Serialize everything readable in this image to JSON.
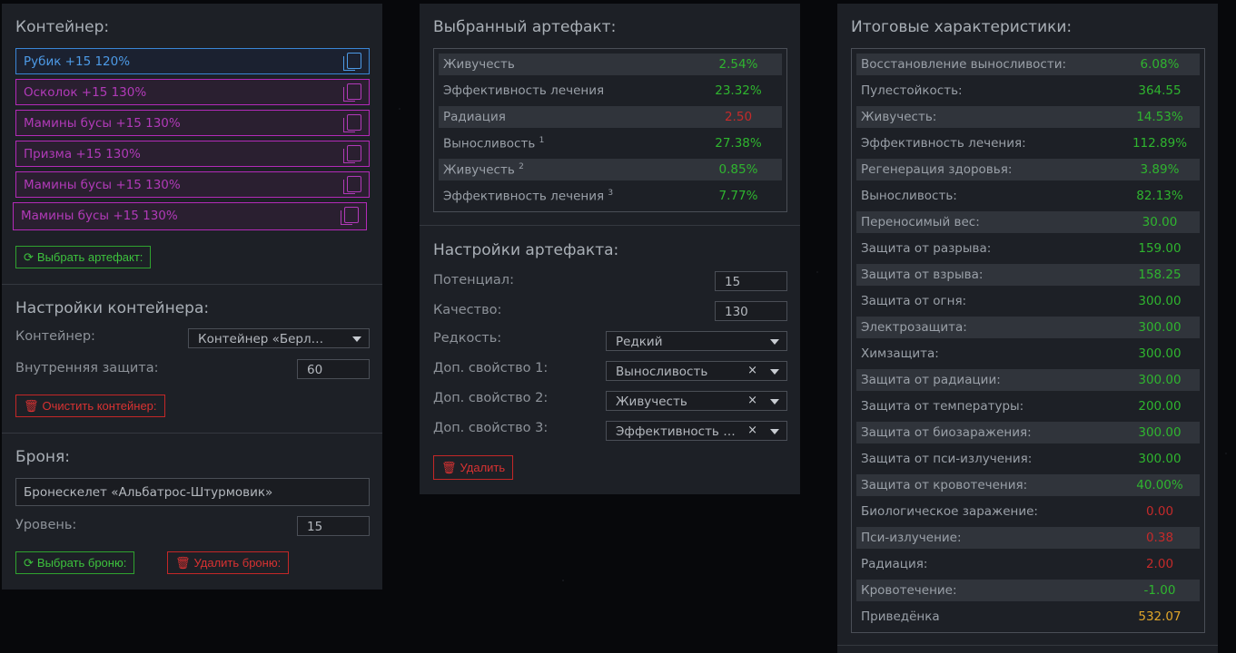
{
  "container_panel": {
    "title": "Контейнер:",
    "slots": [
      {
        "label": "Рубик +15 120%",
        "color": "#4d9ae6"
      },
      {
        "label": "Осколок +15 130%",
        "color": "#b13ab8"
      },
      {
        "label": "Мамины бусы +15 130%",
        "color": "#b13ab8"
      },
      {
        "label": "Призма +15 130%",
        "color": "#b13ab8"
      },
      {
        "label": "Мамины бусы +15 130%",
        "color": "#b13ab8"
      },
      {
        "label": "Мамины бусы +15 130%",
        "color": "#b13ab8"
      }
    ],
    "select_artifact_button": "Выбрать артефакт:",
    "settings_title": "Настройки контейнера:",
    "container_label": "Контейнер:",
    "container_value": "Контейнер «Берлога...",
    "inner_protection_label": "Внутренняя защита:",
    "inner_protection_value": "60",
    "clear_button": "Очистить контейнер:",
    "armor_title": "Броня:",
    "armor_value": "Бронескелет «Альбатрос-Штурмовик»",
    "level_label": "Уровень:",
    "level_value": "15",
    "select_armor_button": "Выбрать броню:",
    "delete_armor_button": "Удалить броню:"
  },
  "artifact_panel": {
    "title": "Выбранный артефакт:",
    "stats": [
      {
        "name": "Живучесть",
        "sup": "",
        "value": "2.54%",
        "tone": "good"
      },
      {
        "name": "Эффективность лечения",
        "sup": "",
        "value": "23.32%",
        "tone": "good"
      },
      {
        "name": "Радиация",
        "sup": "",
        "value": "2.50",
        "tone": "bad"
      },
      {
        "name": "Выносливость",
        "sup": "1",
        "value": "27.38%",
        "tone": "good"
      },
      {
        "name": "Живучесть",
        "sup": "2",
        "value": "0.85%",
        "tone": "good"
      },
      {
        "name": "Эффективность лечения",
        "sup": "3",
        "value": "7.77%",
        "tone": "good"
      }
    ],
    "settings_title": "Настройки артефакта:",
    "potential_label": "Потенциал:",
    "potential_value": "15",
    "quality_label": "Качество:",
    "quality_value": "130",
    "rarity_label": "Редкость:",
    "rarity_value": "Редкий",
    "extra1_label": "Доп. свойство 1:",
    "extra1_value": "Выносливость",
    "extra2_label": "Доп. свойство 2:",
    "extra2_value": "Живучесть",
    "extra3_label": "Доп. свойство 3:",
    "extra3_value": "Эффективность ле...",
    "clear_symbol": "×",
    "delete_button": "Удалить"
  },
  "totals_panel": {
    "title": "Итоговые характеристики:",
    "stats": [
      {
        "name": "Восстановление выносливости:",
        "value": "6.08%",
        "tone": "good"
      },
      {
        "name": "Пулестойкость:",
        "value": "364.55",
        "tone": "good"
      },
      {
        "name": "Живучесть:",
        "value": "14.53%",
        "tone": "good"
      },
      {
        "name": "Эффективность лечения:",
        "value": "112.89%",
        "tone": "good"
      },
      {
        "name": "Регенерация здоровья:",
        "value": "3.89%",
        "tone": "good"
      },
      {
        "name": "Выносливость:",
        "value": "82.13%",
        "tone": "good"
      },
      {
        "name": "Переносимый вес:",
        "value": "30.00",
        "tone": "good"
      },
      {
        "name": "Защита от разрыва:",
        "value": "159.00",
        "tone": "good"
      },
      {
        "name": "Защита от взрыва:",
        "value": "158.25",
        "tone": "good"
      },
      {
        "name": "Защита от огня:",
        "value": "300.00",
        "tone": "good"
      },
      {
        "name": "Электрозащита:",
        "value": "300.00",
        "tone": "good"
      },
      {
        "name": "Химзащита:",
        "value": "300.00",
        "tone": "good"
      },
      {
        "name": "Защита от радиации:",
        "value": "300.00",
        "tone": "good"
      },
      {
        "name": "Защита от температуры:",
        "value": "200.00",
        "tone": "good"
      },
      {
        "name": "Защита от биозаражения:",
        "value": "300.00",
        "tone": "good"
      },
      {
        "name": "Защита от пси-излучения:",
        "value": "300.00",
        "tone": "good"
      },
      {
        "name": "Защита от кровотечения:",
        "value": "40.00%",
        "tone": "good"
      },
      {
        "name": "Биологическое заражение:",
        "value": "0.00",
        "tone": "bad"
      },
      {
        "name": "Пси-излучение:",
        "value": "0.38",
        "tone": "bad"
      },
      {
        "name": "Радиация:",
        "value": "2.00",
        "tone": "bad"
      },
      {
        "name": "Кровотечение:",
        "value": "-1.00",
        "tone": "good"
      },
      {
        "name": "Приведёнка",
        "value": "532.07",
        "tone": "accent"
      }
    ]
  },
  "colors": {
    "good": "#2fb52f",
    "bad": "#c42a2a",
    "accent": "#e0a62a",
    "rare_slot": "#b13ab8",
    "common_slot": "#4d9ae6"
  }
}
